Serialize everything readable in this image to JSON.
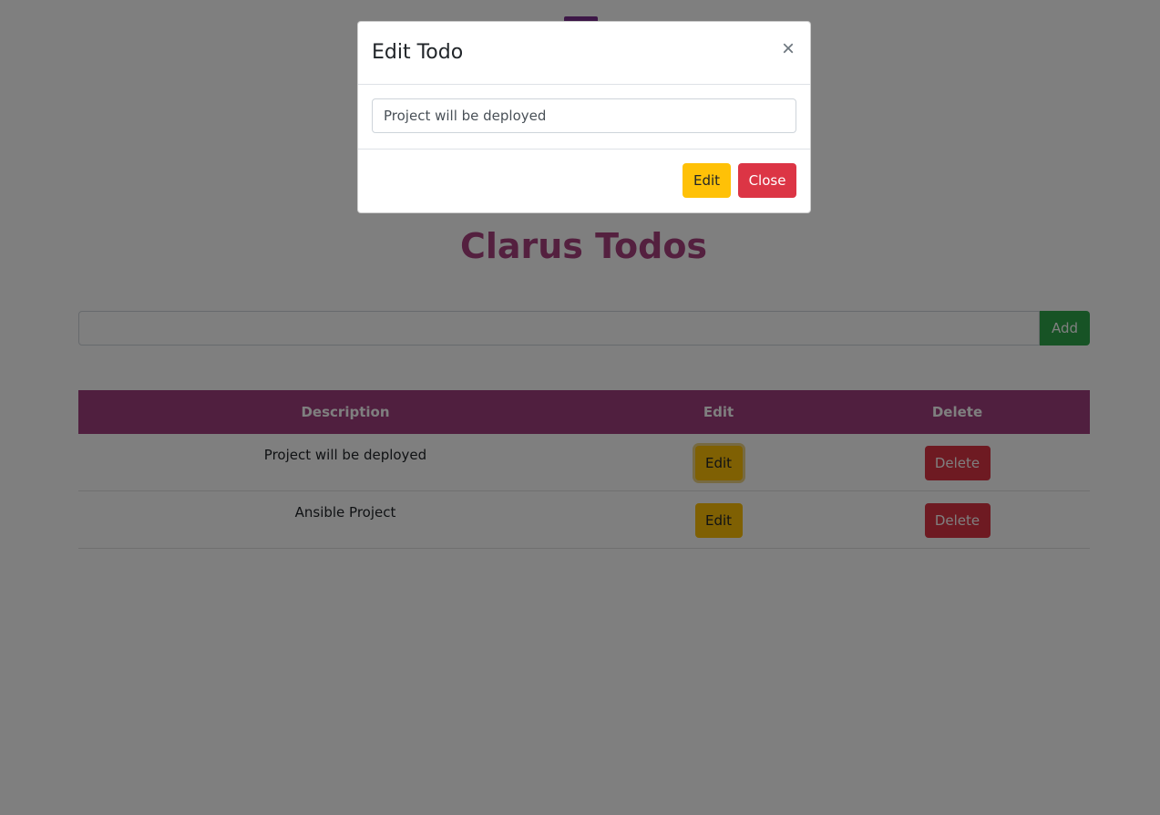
{
  "header": {
    "title": "Clarus Todos"
  },
  "add_form": {
    "input_value": "",
    "add_label": "Add"
  },
  "table": {
    "columns": [
      "Description",
      "Edit",
      "Delete"
    ],
    "rows": [
      {
        "description": "Project will be deployed",
        "edit_label": "Edit",
        "delete_label": "Delete"
      },
      {
        "description": "Ansible Project",
        "edit_label": "Edit",
        "delete_label": "Delete"
      }
    ]
  },
  "modal": {
    "title": "Edit Todo",
    "close_symbol": "×",
    "input_value": "Project will be deployed",
    "edit_label": "Edit",
    "close_label": "Close"
  },
  "colors": {
    "brand": "#a03f7f",
    "warning": "#ffc107",
    "danger": "#dc3545",
    "success": "#2fa64a"
  },
  "icons": {
    "logo": "logo-icon",
    "close": "close-icon"
  }
}
